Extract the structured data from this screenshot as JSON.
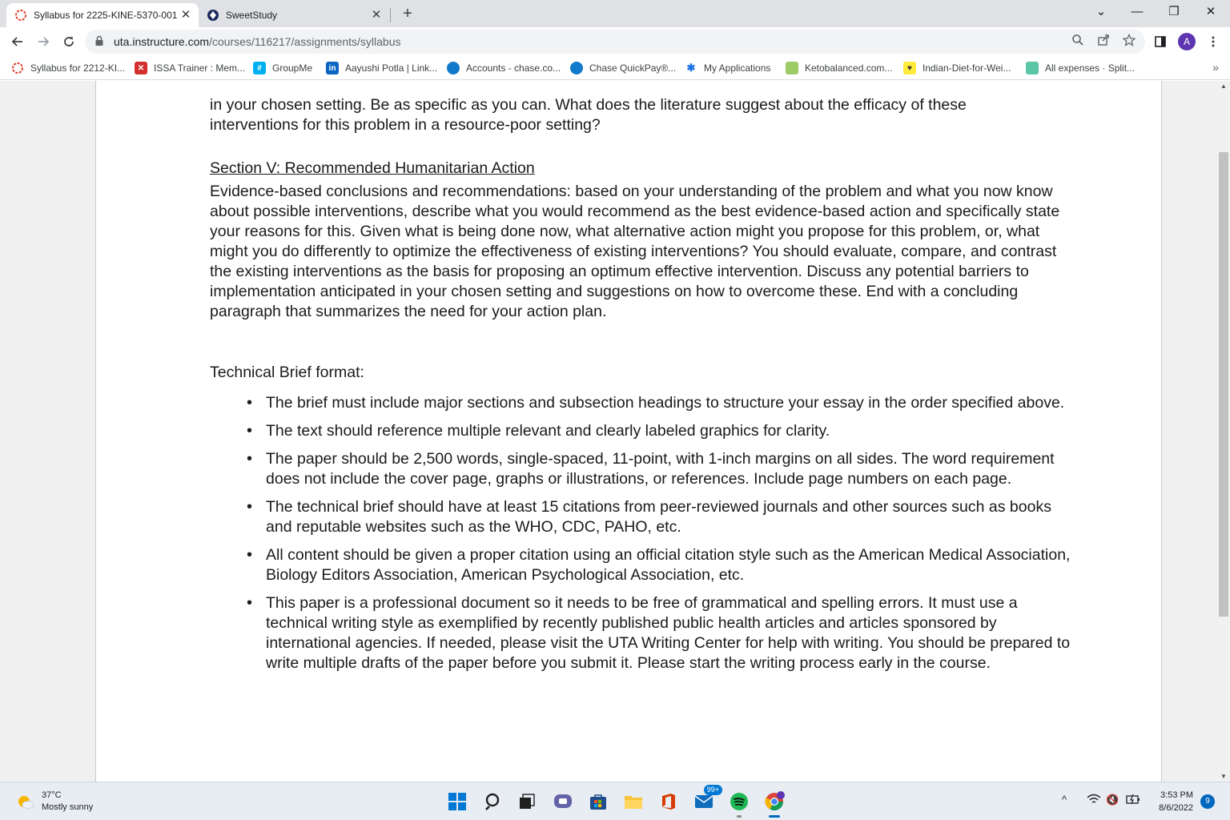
{
  "browser": {
    "tabs": [
      {
        "title": "Syllabus for 2225-KINE-5370-001",
        "close": "✕"
      },
      {
        "title": "SweetStudy",
        "close": "✕"
      }
    ],
    "new_tab": "+",
    "window_controls": {
      "tab_search": "⌄",
      "minimize": "—",
      "restore": "❐",
      "close": "✕"
    },
    "url_host": "uta.instructure.com",
    "url_path": "/courses/116217/assignments/syllabus",
    "avatar_letter": "A",
    "bookmarks": [
      "Syllabus for 2212-KI...",
      "ISSA Trainer : Mem...",
      "GroupMe",
      "Aayushi Potla | Link...",
      "Accounts - chase.co...",
      "Chase QuickPay®...",
      "My Applications",
      "Ketobalanced.com...",
      "Indian-Diet-for-Wei...",
      "All expenses · Split..."
    ],
    "bookmarks_overflow": "»"
  },
  "document": {
    "intro_line1": "in your chosen setting. Be as specific as you can. What does the literature suggest about the efficacy of these",
    "intro_line2": "interventions for this problem in a resource-poor setting?",
    "section_heading": "Section V: Recommended Humanitarian Action",
    "section_body": "Evidence-based conclusions and recommendations: based on your understanding of the problem and what you now know about possible interventions, describe what you would recommend as the best evidence-based action and specifically state your reasons for this. Given what is being done now, what alternative action might you propose for this problem, or, what might you do differently to optimize the effectiveness of existing interventions? You should evaluate, compare, and contrast the existing interventions as the basis for proposing an optimum effective intervention. Discuss any potential barriers to implementation anticipated in your chosen setting and suggestions on how to overcome these. End with a concluding paragraph that summarizes the need for your action plan.",
    "brief_title": "Technical Brief format:",
    "bullets": [
      "The brief must include major sections and subsection headings to structure your essay in the order specified above.",
      "The text should reference multiple relevant and clearly labeled graphics for clarity.",
      "The paper should be 2,500 words, single-spaced, 11-point, with 1-inch margins on all sides. The word requirement does not include the cover page, graphs or illustrations, or references. Include page numbers on each page.",
      "The technical brief should have at least 15 citations from peer-reviewed journals and other sources such as books and reputable websites such as the WHO, CDC, PAHO, etc.",
      "All content should be given a proper citation using an official citation style such as the American Medical Association, Biology Editors Association, American Psychological Association, etc.",
      "This paper is a professional document so it needs to be free of grammatical and spelling errors. It must use a technical writing style as exemplified by recently published public health articles and articles sponsored by international agencies. If needed, please visit the UTA Writing Center for help with writing. You should be prepared to write multiple drafts of the paper before you submit it. Please start the writing process early in the course."
    ]
  },
  "taskbar": {
    "weather_temp": "37°C",
    "weather_desc": "Mostly sunny",
    "mail_badge": "99+",
    "time": "3:53 PM",
    "date": "8/6/2022",
    "notification_count": "9",
    "tray": {
      "chevron": "^",
      "volume": "🔇"
    }
  },
  "colors": {
    "tab_strip": "#dfe1e5",
    "avatar": "#5e35b1",
    "taskbar": "#e8edf3",
    "accent": "#0067c0"
  }
}
